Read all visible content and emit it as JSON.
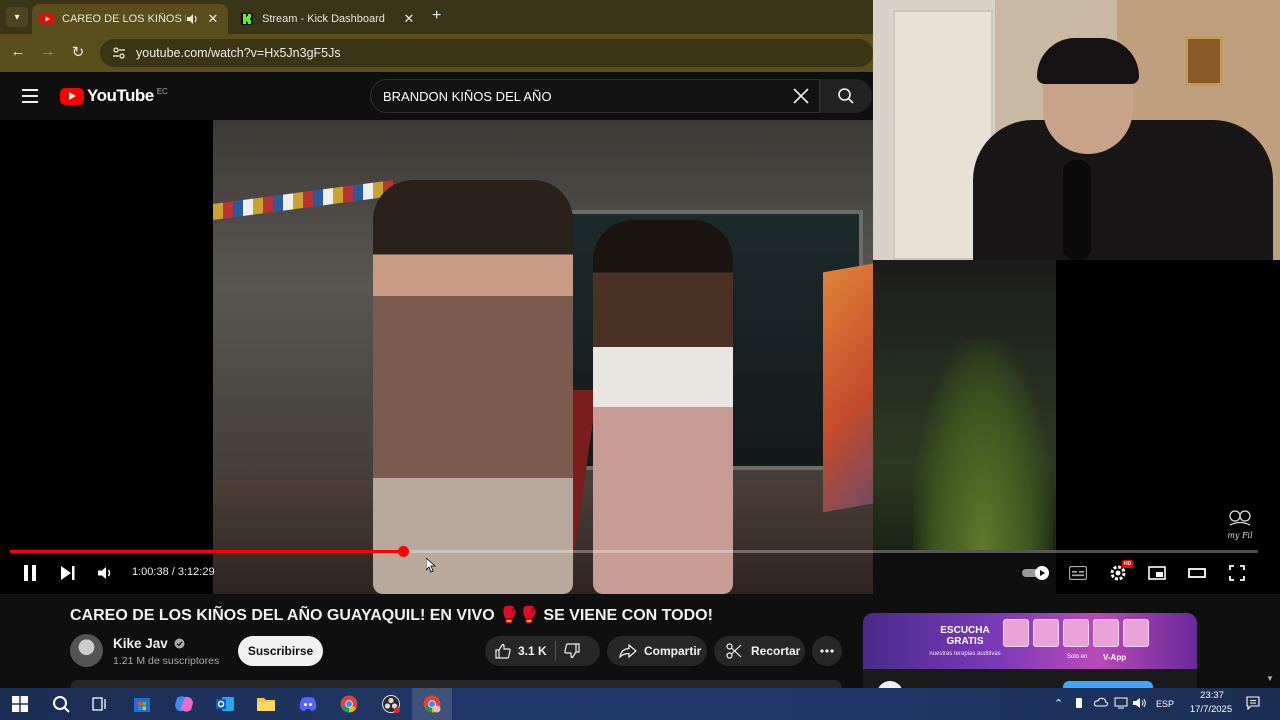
{
  "browser": {
    "tabs": [
      {
        "label": "CAREO DE LOS KIÑOS DEL AÑO",
        "active": true,
        "favicon": "youtube-icon",
        "audio": true
      },
      {
        "label": "Stream - Kick Dashboard",
        "active": false,
        "favicon": "kick-icon"
      }
    ],
    "url": "youtube.com/watch?v=Hx5Jn3gF5Js",
    "accent": "#5a4f1c"
  },
  "youtube": {
    "logo_text": "YouTube",
    "country_code": "EC",
    "search_query": "BRANDON KIÑOS DEL AÑO"
  },
  "player": {
    "current_time": "1:00:38",
    "duration": "3:12:29",
    "time_display": "1:00:38 / 3:12:29",
    "progress": 0.315,
    "settings_badge": "HD",
    "watermark": "my Fil"
  },
  "video": {
    "title": "CAREO DE LOS KIÑOS DEL AÑO GUAYAQUIL! EN VIVO 🥊🥊 SE VIENE CON TODO!",
    "channel": "Kike Jav",
    "subscribers": "1.21 M de suscriptores",
    "subscribe_label": "Suscribirse",
    "likes": "3.1 K",
    "share_label": "Compartir",
    "clip_label": "Recortar"
  },
  "ad": {
    "headline": "ESCUCHA GRATIS",
    "subline": "nuestras terapias auditivas",
    "cta": "Solo en",
    "brand": "V-App"
  },
  "taskbar": {
    "language": "ESP",
    "time": "23:37",
    "date": "17/7/2025"
  },
  "colors": {
    "youtube_red": "#ff0000",
    "kick_green": "#53fc18",
    "taskbar": "#21386a"
  }
}
